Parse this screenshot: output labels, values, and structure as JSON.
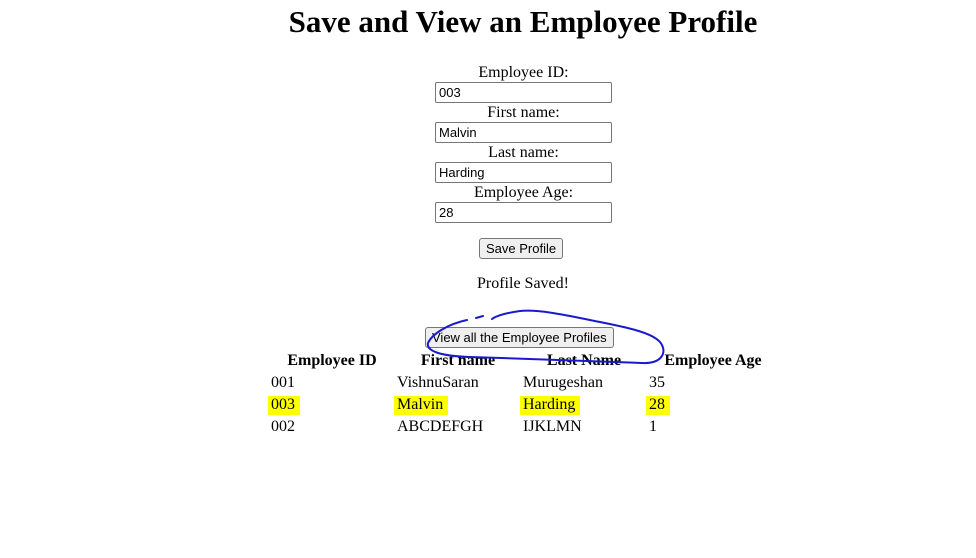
{
  "header": {
    "title": "Save and View an Employee Profile"
  },
  "form": {
    "employee_id": {
      "label": "Employee ID:",
      "value": "003"
    },
    "first_name": {
      "label": "First name:",
      "value": "Malvin"
    },
    "last_name": {
      "label": "Last name:",
      "value": "Harding"
    },
    "age": {
      "label": "Employee Age:",
      "value": "28"
    },
    "save_label": "Save Profile"
  },
  "status": {
    "message": "Profile Saved!"
  },
  "view_button": {
    "label": "View all the Employee Profiles"
  },
  "table": {
    "headers": [
      "Employee ID",
      "First name",
      "Last Name",
      "Employee Age"
    ],
    "rows": [
      {
        "id": "001",
        "first": "VishnuSaran",
        "last": "Murugeshan",
        "age": "35",
        "highlighted": false
      },
      {
        "id": "003",
        "first": "Malvin",
        "last": "Harding",
        "age": "28",
        "highlighted": true
      },
      {
        "id": "002",
        "first": "ABCDEFGH",
        "last": "IJKLMN",
        "age": "1",
        "highlighted": false
      }
    ]
  },
  "colors": {
    "highlight": "#ffff00",
    "annotation_ink": "#1a1acc"
  }
}
